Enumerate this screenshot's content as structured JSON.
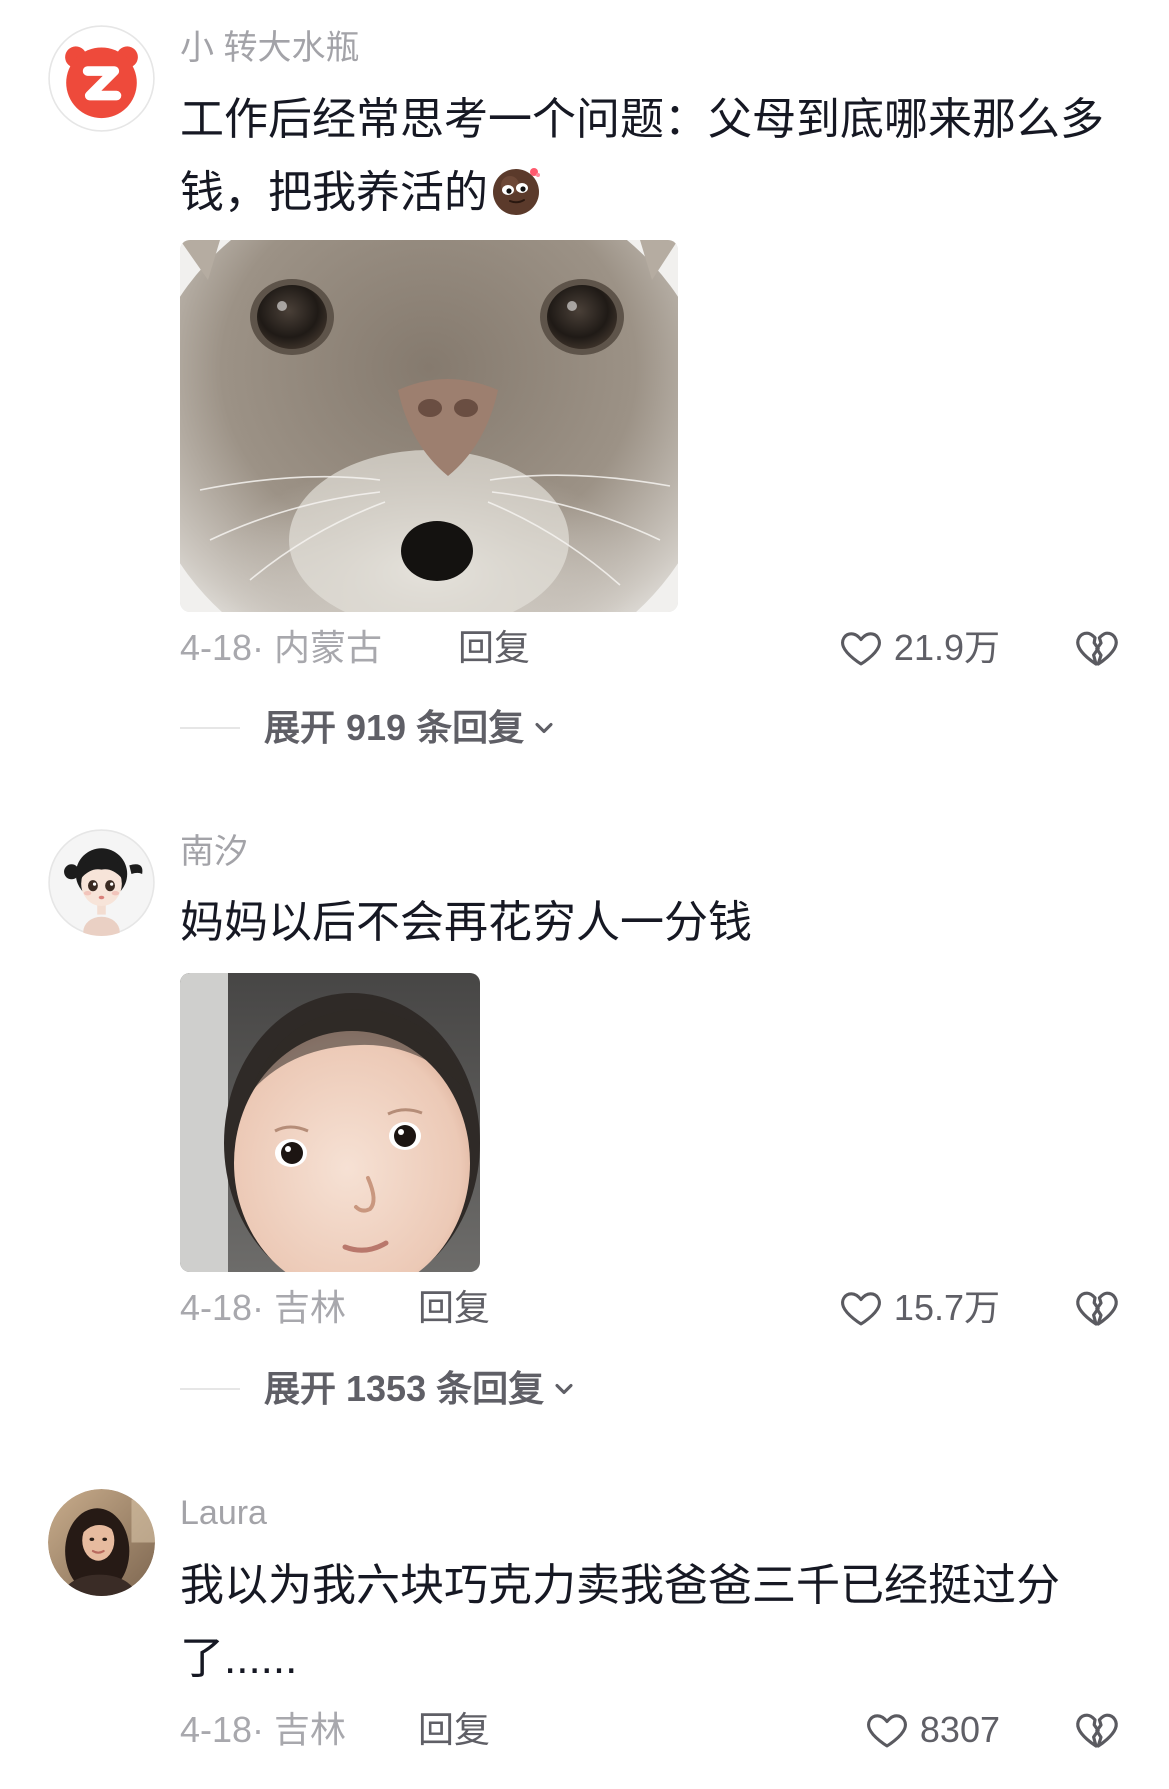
{
  "theme": {
    "text": "#161823",
    "username": "#a3a3a8",
    "meta": "#a8a8ad",
    "action": "#5f5f66",
    "icon": "#5a5a60",
    "divider": "#e6e6e6",
    "background": "#ffffff"
  },
  "icons": {
    "like": "heart-outline-icon",
    "dislike": "broken-heart-icon",
    "expand": "chevron-down-icon",
    "emoji": "face-emoji-icon"
  },
  "comments": [
    {
      "username": "小 转大水瓶",
      "text_lines": [
        "工作后经常思考一个问题：父母到底哪来那么多",
        "钱，把我养活的"
      ],
      "date_location": "4-18· 内蒙古",
      "reply_label": "回复",
      "likes": "21.9万",
      "expand_label": "展开 919 条回复"
    },
    {
      "username": "南汐",
      "text_lines": [
        "妈妈以后不会再花穷人一分钱"
      ],
      "date_location": "4-18· 吉林",
      "reply_label": "回复",
      "likes": "15.7万",
      "expand_label": "展开 1353 条回复"
    },
    {
      "username": "Laura",
      "text_lines": [
        "我以为我六块巧克力卖我爸爸三千已经挺过分",
        "了......"
      ],
      "date_location": "4-18· 吉林",
      "reply_label": "回复",
      "likes": "8307"
    }
  ]
}
